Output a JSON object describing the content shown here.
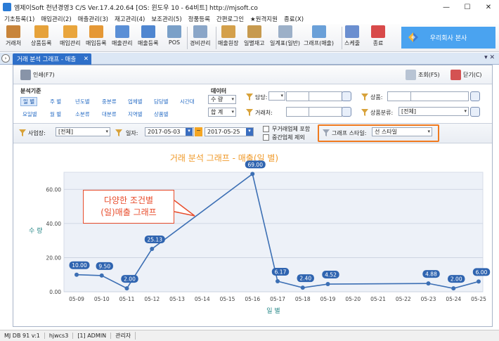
{
  "window": {
    "title": "엠제이Soft 천년경영3 C/S   Ver.17.4.20.64   [OS: 윈도우 10 - 64비트]   http://mjsoft.co",
    "minimize": "—",
    "maximize": "☐",
    "close": "✕"
  },
  "menu": [
    "기초등록(1)",
    "매입관리(2)",
    "매출관리(3)",
    "재고관리(4)",
    "보조관리(5)",
    "정품등록",
    "간편로그인",
    "★원격지원",
    "종료(X)"
  ],
  "toolbar": {
    "buttons": [
      "거래처",
      "상품등록",
      "매입관리",
      "매입등록",
      "매출관리",
      "매출등록",
      "POS",
      "경비관리",
      "매출원장",
      "일별재고",
      "일계표(일반)",
      "그래프(매출)",
      "스케줄",
      "종료"
    ],
    "company": "우리회사 본사"
  },
  "tab": {
    "label": "거래 분석 그래프 - 매출",
    "close": "✕",
    "nav": "›",
    "controls": "▾ ✕"
  },
  "subbar": {
    "print": "인쇄(F7)",
    "query": "조회(F5)",
    "close": "닫기(C)"
  },
  "filters": {
    "analysis_label": "분석기준",
    "period_options": [
      "일 별",
      "주 별",
      "년도별",
      "중분류",
      "업체별",
      "담당별",
      "시간대",
      "요일별",
      "월 별",
      "소분류",
      "대분류",
      "지역별",
      "상품별"
    ],
    "selected_period": "일 별",
    "data_label": "데이터",
    "data_value": "수 량",
    "sum_value": "합 계",
    "manager_label": "담당:",
    "client_label": "거래처:",
    "product_label": "상품:",
    "category_label": "상품분류:",
    "category_value": "[전체]",
    "business_label": "사업장:",
    "business_value": "[전체]",
    "date_label": "일자:",
    "date_from": "2017-05-03",
    "date_to": "2017-05-25",
    "date_sep": "~",
    "opt_include_no_trade": "무거래업체 포함",
    "opt_exclude_mid": "중간업체 제외",
    "style_label": "그래프 스타일:",
    "style_value": "선 스타일"
  },
  "chart_data": {
    "type": "line",
    "title": "거래 분석 그래프 - 매출(일   별)",
    "xlabel": "일   별",
    "ylabel": "수 량",
    "x": [
      "05-09",
      "05-10",
      "05-11",
      "05-12",
      "05-13",
      "05-14",
      "05-15",
      "05-16",
      "05-17",
      "05-18",
      "05-19",
      "05-20",
      "05-21",
      "05-22",
      "05-23",
      "05-24",
      "05-25"
    ],
    "values": [
      10.0,
      9.5,
      2.0,
      25.13,
      null,
      null,
      null,
      69.0,
      6.17,
      2.4,
      4.52,
      null,
      null,
      null,
      4.88,
      2.0,
      6.0
    ],
    "labels": [
      "10.00",
      "9.50",
      "2.00",
      "25.13",
      "",
      "",
      "",
      "69.00",
      "6.17",
      "2.40",
      "4.52",
      "",
      "",
      "",
      "4.88",
      "2.00",
      "6.00"
    ],
    "yticks": [
      "0.00",
      "20.00",
      "40.00",
      "60.00"
    ],
    "ylim": [
      0,
      70
    ],
    "grid": true,
    "colors": {
      "line": "#3c6fb4",
      "title": "#f09a2a",
      "axis_label": "#2c8a8a",
      "plot_bg": "#edf1f8"
    }
  },
  "callout": {
    "line1": "다양한 조건별",
    "line2": "(일)매출 그래프"
  },
  "status": [
    "MJ DB 91 v:1",
    "hjwcs3",
    "[1] ADMIN",
    "관리자"
  ]
}
